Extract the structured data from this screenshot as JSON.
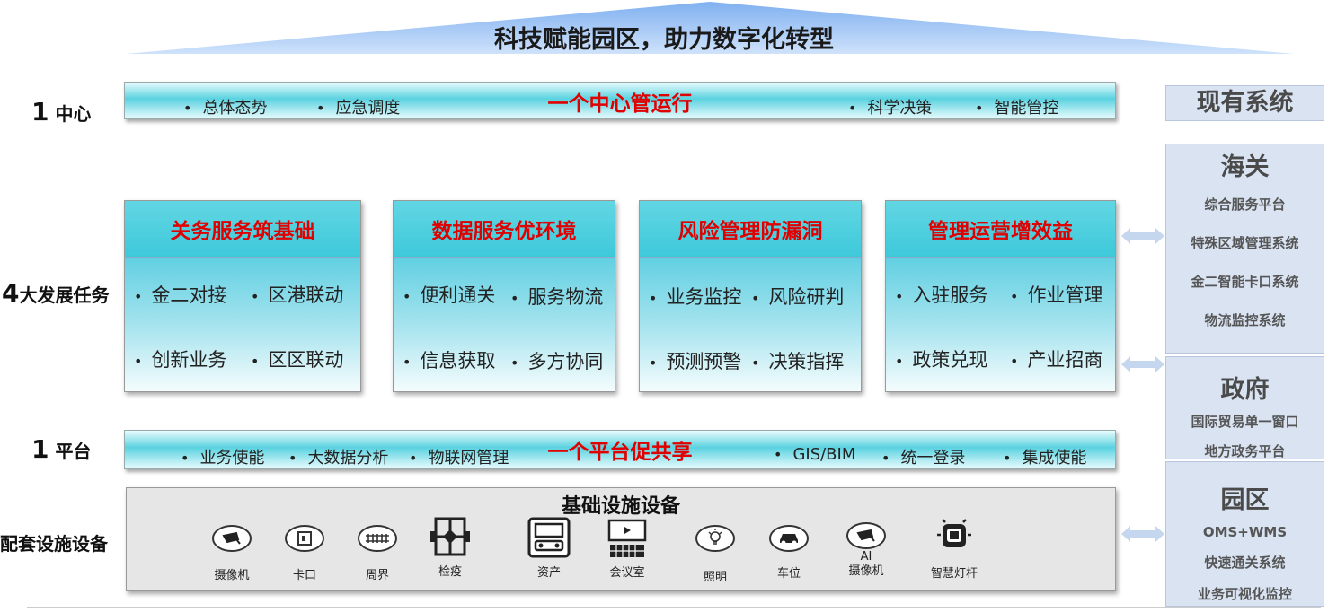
{
  "title": "科技赋能园区，助力数字化转型",
  "side_labels": {
    "center": {
      "num": "1",
      "text": "中心"
    },
    "tasks": {
      "num": "4",
      "text": "大发展任务"
    },
    "platform": {
      "num": "1",
      "text": "平台"
    },
    "infra": {
      "text": "配套设施设备"
    }
  },
  "center_bar": {
    "title": "一个中心管运行",
    "left_items": [
      "总体态势",
      "应急调度"
    ],
    "right_items": [
      "科学决策",
      "智能管控"
    ]
  },
  "tasks": [
    {
      "title": "关务服务筑基础",
      "items": [
        "金二对接",
        "区港联动",
        "创新业务",
        "区区联动"
      ]
    },
    {
      "title": "数据服务优环境",
      "items": [
        "便利通关",
        "服务物流",
        "信息获取",
        "多方协同"
      ]
    },
    {
      "title": "风险管理防漏洞",
      "items": [
        "业务监控",
        "风险研判",
        "预测预警",
        "决策指挥"
      ]
    },
    {
      "title": "管理运营增效益",
      "items": [
        "入驻服务",
        "作业管理",
        "政策兑现",
        "产业招商"
      ]
    }
  ],
  "platform_bar": {
    "title": "一个平台促共享",
    "left_items": [
      "业务使能",
      "大数据分析",
      "物联网管理"
    ],
    "right_items": [
      "GIS/BIM",
      "统一登录",
      "集成使能"
    ]
  },
  "infra": {
    "title": "基础设施设备",
    "devices": [
      {
        "icon": "camera-icon",
        "label": "摄像机"
      },
      {
        "icon": "gate-icon",
        "label": "卡口"
      },
      {
        "icon": "fence-icon",
        "label": "周界"
      },
      {
        "icon": "quarantine-icon",
        "label": "检疫"
      },
      {
        "icon": "asset-icon",
        "label": "资产"
      },
      {
        "icon": "meeting-room-icon",
        "label": "会议室"
      },
      {
        "icon": "lighting-icon",
        "label": "照明"
      },
      {
        "icon": "parking-icon",
        "label": "车位"
      },
      {
        "icon": "ai-camera-icon",
        "label_top": "AI",
        "label": "摄像机"
      },
      {
        "icon": "smart-pole-icon",
        "label": "智慧灯杆"
      }
    ]
  },
  "right_panel": {
    "header": "现有系统",
    "sections": [
      {
        "title": "海关",
        "items": [
          "综合服务平台",
          "特殊区域管理系统",
          "金二智能卡口系统",
          "物流监控系统"
        ]
      },
      {
        "title": "政府",
        "items": [
          "国际贸易单一窗口",
          "地方政务平台"
        ]
      },
      {
        "title": "园区",
        "items": [
          "OMS+WMS",
          "快速通关系统",
          "业务可视化监控"
        ]
      }
    ]
  },
  "colors": {
    "accent_red": "#e00000",
    "cyan": "#3ec9da",
    "panel": "#d9e3f2",
    "arrow": "#c5d7ee"
  }
}
